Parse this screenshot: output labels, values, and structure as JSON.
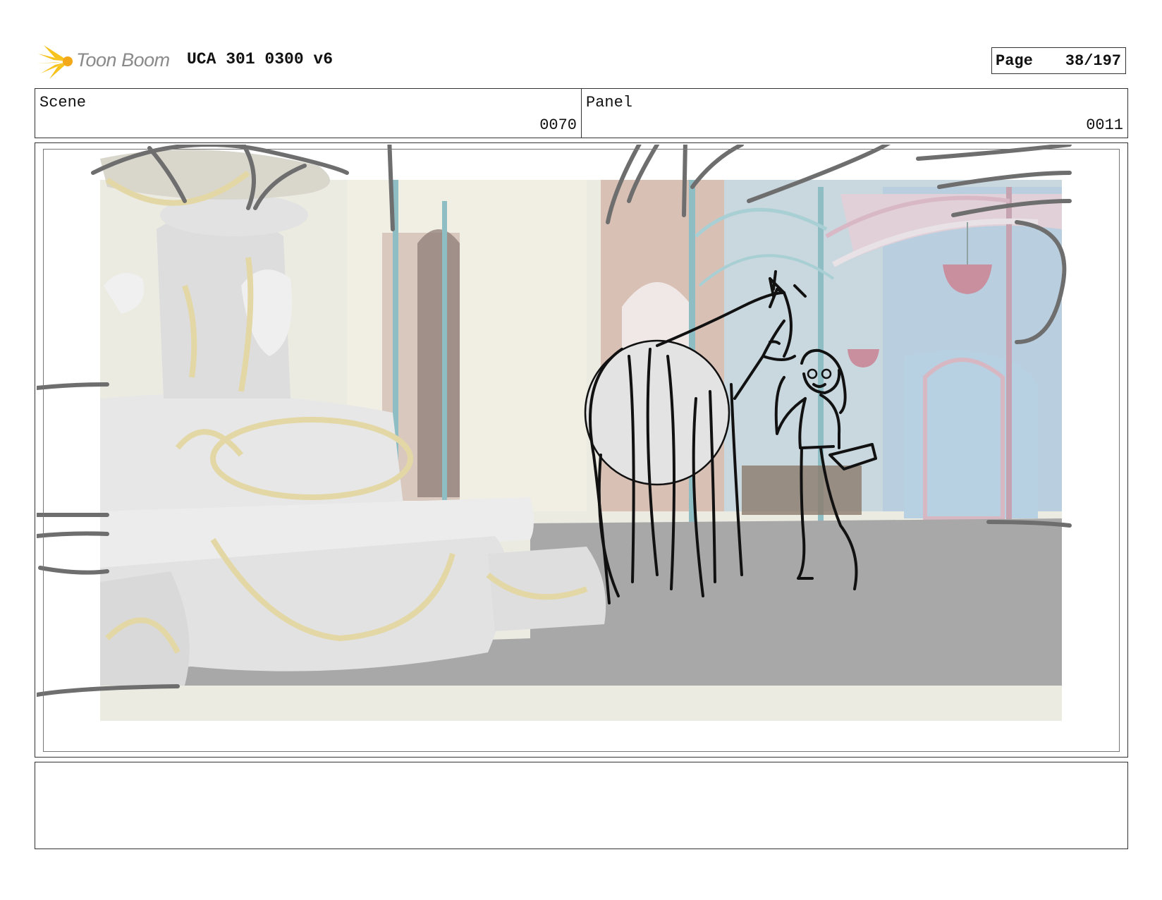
{
  "header": {
    "logo_text": "Toon Boom",
    "document_title": "UCA 301 0300 v6",
    "page_label": "Page",
    "page_value": "38/197"
  },
  "info": {
    "scene_label": "Scene",
    "scene_number": "0070",
    "panel_label": "Panel",
    "panel_number": "0011"
  },
  "panel_image": {
    "icon": "storyboard-drawing",
    "colors": {
      "floor": "#a8a8a8",
      "wall_left": "#efede2",
      "wall_right_blue": "#b9cfdf",
      "arch_pink": "#d7b7c2",
      "pillar_teal": "#8fbdc4",
      "fountain": "#e6e6e6",
      "fountain_vines": "#e3d7a5",
      "sketch_line": "#111111",
      "rough_line": "#6e6e6e"
    }
  },
  "notes": {
    "text": ""
  }
}
